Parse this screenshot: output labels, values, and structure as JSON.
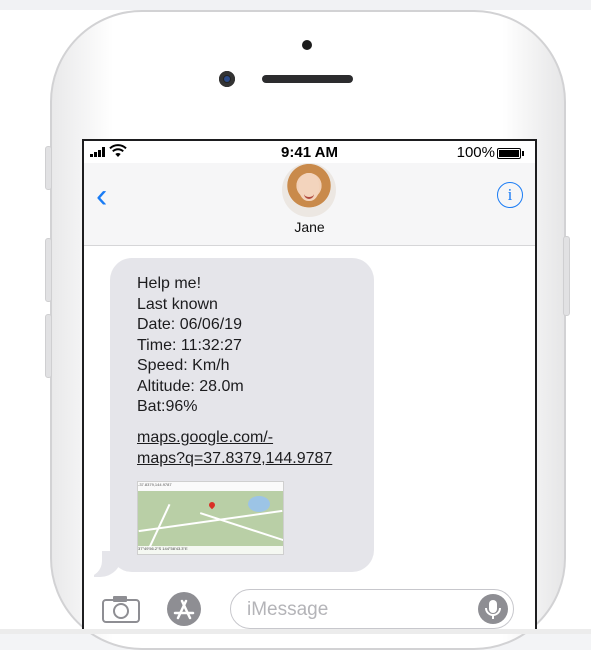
{
  "statusbar": {
    "time": "9:41 AM",
    "battery": "100%"
  },
  "navbar": {
    "contact_name": "Jane",
    "back_icon": "chevron-left-icon",
    "info_icon": "info-icon"
  },
  "message": {
    "lines": [
      "Help me!",
      "Last known",
      "Date: 06/06/19",
      "Time: 11:32:27",
      "Speed: Km/h",
      "Altitude: 28.0m",
      "Bat:96%"
    ],
    "link_lines": [
      "maps.google.com/-",
      "maps?q=37.8379,144.9787"
    ]
  },
  "map_preview": {
    "top_text": "-37.8379,144.9787",
    "label_text": "37°49'56.2\"S 144°58'43.3\"E"
  },
  "composer": {
    "placeholder": "iMessage"
  },
  "colors": {
    "accent": "#1a7cf5",
    "bubble": "#e5e5ea"
  }
}
